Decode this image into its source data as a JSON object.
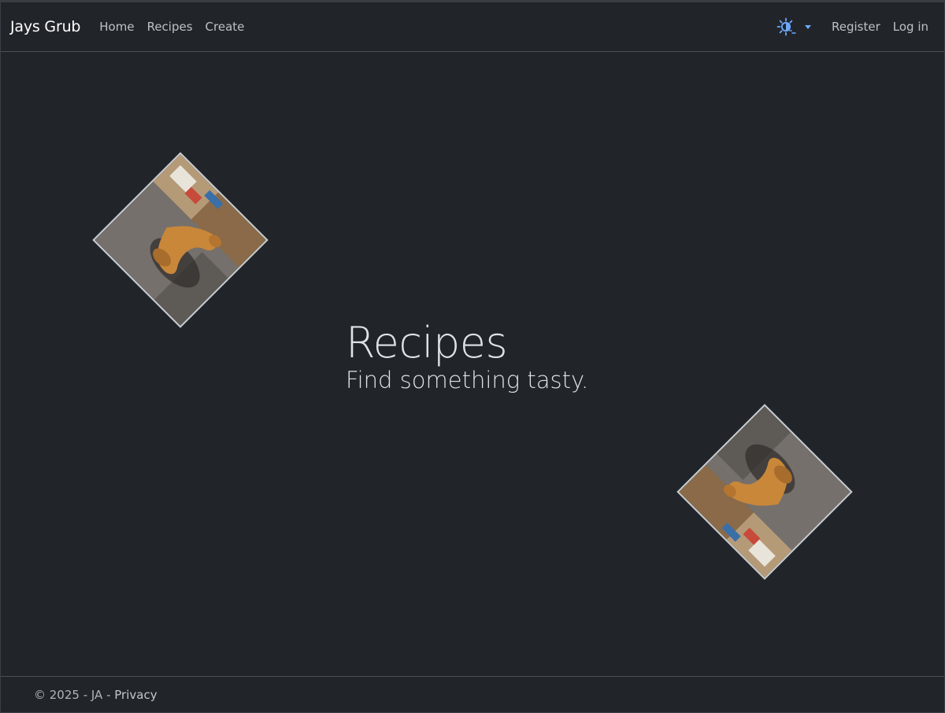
{
  "navbar": {
    "brand": "Jays Grub",
    "links": [
      {
        "label": "Home"
      },
      {
        "label": "Recipes"
      },
      {
        "label": "Create"
      }
    ],
    "theme_toggle_icon": "sun-moon-icon",
    "auth": {
      "register": "Register",
      "login": "Log in"
    }
  },
  "hero": {
    "title": "Recipes",
    "subtitle": "Find something tasty."
  },
  "footer": {
    "copyright": "© 2025 - JA - ",
    "privacy": "Privacy"
  },
  "colors": {
    "background": "#212529",
    "text": "#dee2e6",
    "accent": "#6ea8fe",
    "border": "#495057"
  }
}
